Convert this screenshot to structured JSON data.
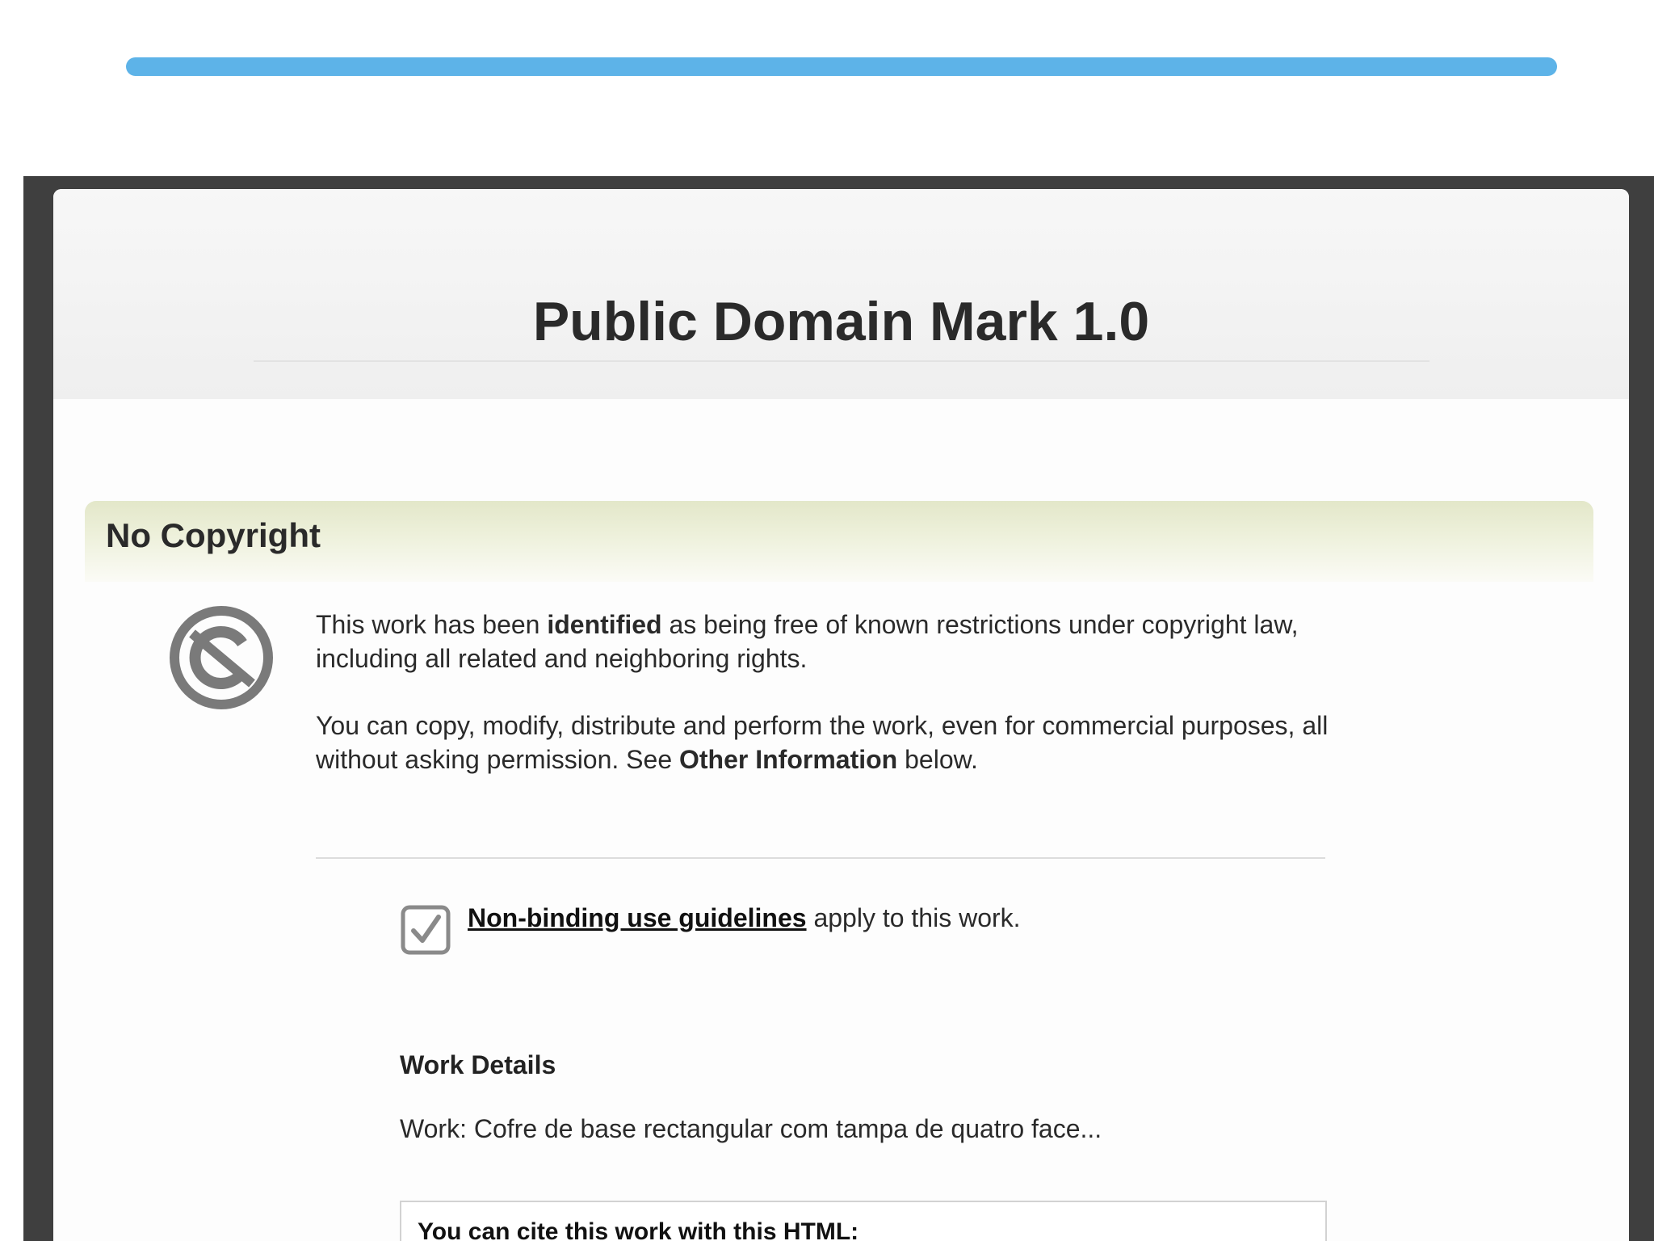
{
  "page": {
    "title": "Public Domain Mark 1.0"
  },
  "loading_bar": {
    "progress_percent": 100,
    "color": "#5db3e8"
  },
  "section": {
    "title": "No Copyright",
    "icon": "public-domain-icon",
    "para1_before": "This work has been ",
    "para1_bold": "identified",
    "para1_after": " as being free of known restrictions under copyright law, including all related and neighboring rights.",
    "para2_before": "You can copy, modify, distribute and perform the work, even for commercial purposes, all without asking permission. See ",
    "para2_bold": "Other Information",
    "para2_after": " below."
  },
  "guidelines": {
    "icon": "checkbox-checked-icon",
    "link_label": "Non-binding use guidelines",
    "suffix": " apply to this work."
  },
  "work_details": {
    "title": "Work Details",
    "work_line": "Work: Cofre de base rectangular com tampa de quatro face..."
  },
  "cite": {
    "title": "You can cite this work with this HTML:"
  },
  "colors": {
    "accent_blue": "#5db3e8",
    "section_green": "#e3e7c9",
    "frame_dark": "#3f3f3f"
  }
}
